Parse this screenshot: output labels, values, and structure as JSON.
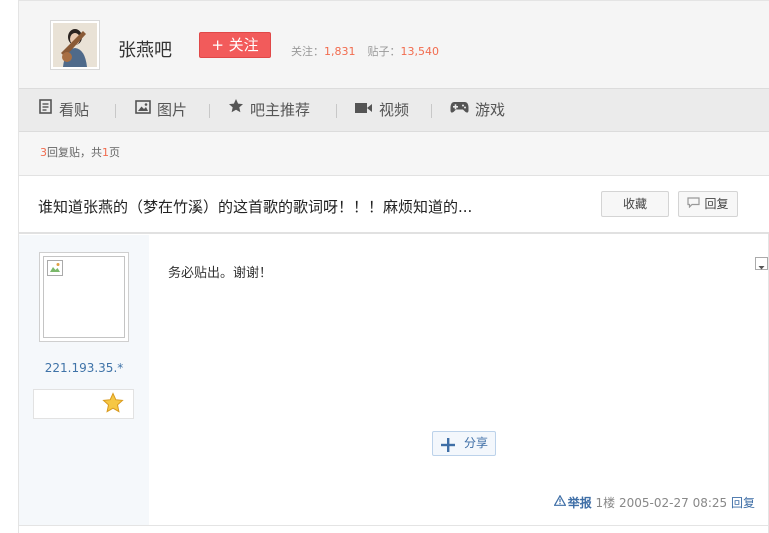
{
  "header": {
    "forum_name": "张燕吧",
    "follow_label": "+ 关注",
    "stats": {
      "followers_label": "关注：",
      "followers_value": "1,831",
      "posts_label": "贴子：",
      "posts_value": "13,540"
    }
  },
  "nav": {
    "tabs": [
      {
        "label": "看贴",
        "icon": "document-icon"
      },
      {
        "label": "图片",
        "icon": "image-icon"
      },
      {
        "label": "吧主推荐",
        "icon": "star-icon"
      },
      {
        "label": "视频",
        "icon": "video-icon"
      },
      {
        "label": "游戏",
        "icon": "gamepad-icon"
      }
    ]
  },
  "thread": {
    "reply_count": "3",
    "reply_text": "回复贴，共",
    "page_count": "1",
    "page_text": "页",
    "title": "谁知道张燕的（梦在竹溪）的这首歌的歌词呀！！！麻烦知道的...",
    "collect_label": "收藏",
    "reply_label": "回复"
  },
  "post": {
    "username": "221.193.35.*",
    "text": "务必贴出。谢谢！",
    "share_label": "分享",
    "report_label": "举报",
    "floor": "1楼",
    "timestamp": "2005-02-27 08:25",
    "reply_link": "回复"
  },
  "colors": {
    "accent_red": "#f25b5b",
    "number_orange": "#f26c4f",
    "link_blue": "#3e6ea6"
  }
}
